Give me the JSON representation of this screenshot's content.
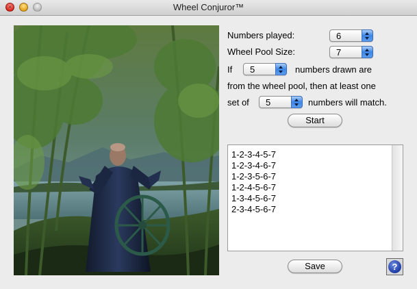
{
  "window": {
    "title": "Wheel Conjuror™"
  },
  "controls": {
    "numbers_played_label": "Numbers played:",
    "numbers_played_value": "6",
    "wheel_pool_size_label": "Wheel Pool Size:",
    "wheel_pool_size_value": "7",
    "if_label": "If",
    "drawn_value": "5",
    "drawn_label": "numbers drawn are",
    "from_pool_label": "from the wheel pool, then at least one",
    "set_of_label": "set of",
    "match_value": "5",
    "match_label": "numbers will match.",
    "start_label": "Start"
  },
  "results": {
    "rows": [
      "1-2-3-4-5-7",
      "1-2-3-4-6-7",
      "1-2-3-5-6-7",
      "1-2-4-5-6-7",
      "1-3-4-5-6-7",
      "2-3-4-5-6-7"
    ]
  },
  "footer": {
    "save_label": "Save",
    "help_glyph": "?"
  },
  "icons": {
    "help": "help-icon"
  },
  "colors": {
    "popup_accent": "#3d86e6",
    "help_blue": "#1c3aa3"
  }
}
